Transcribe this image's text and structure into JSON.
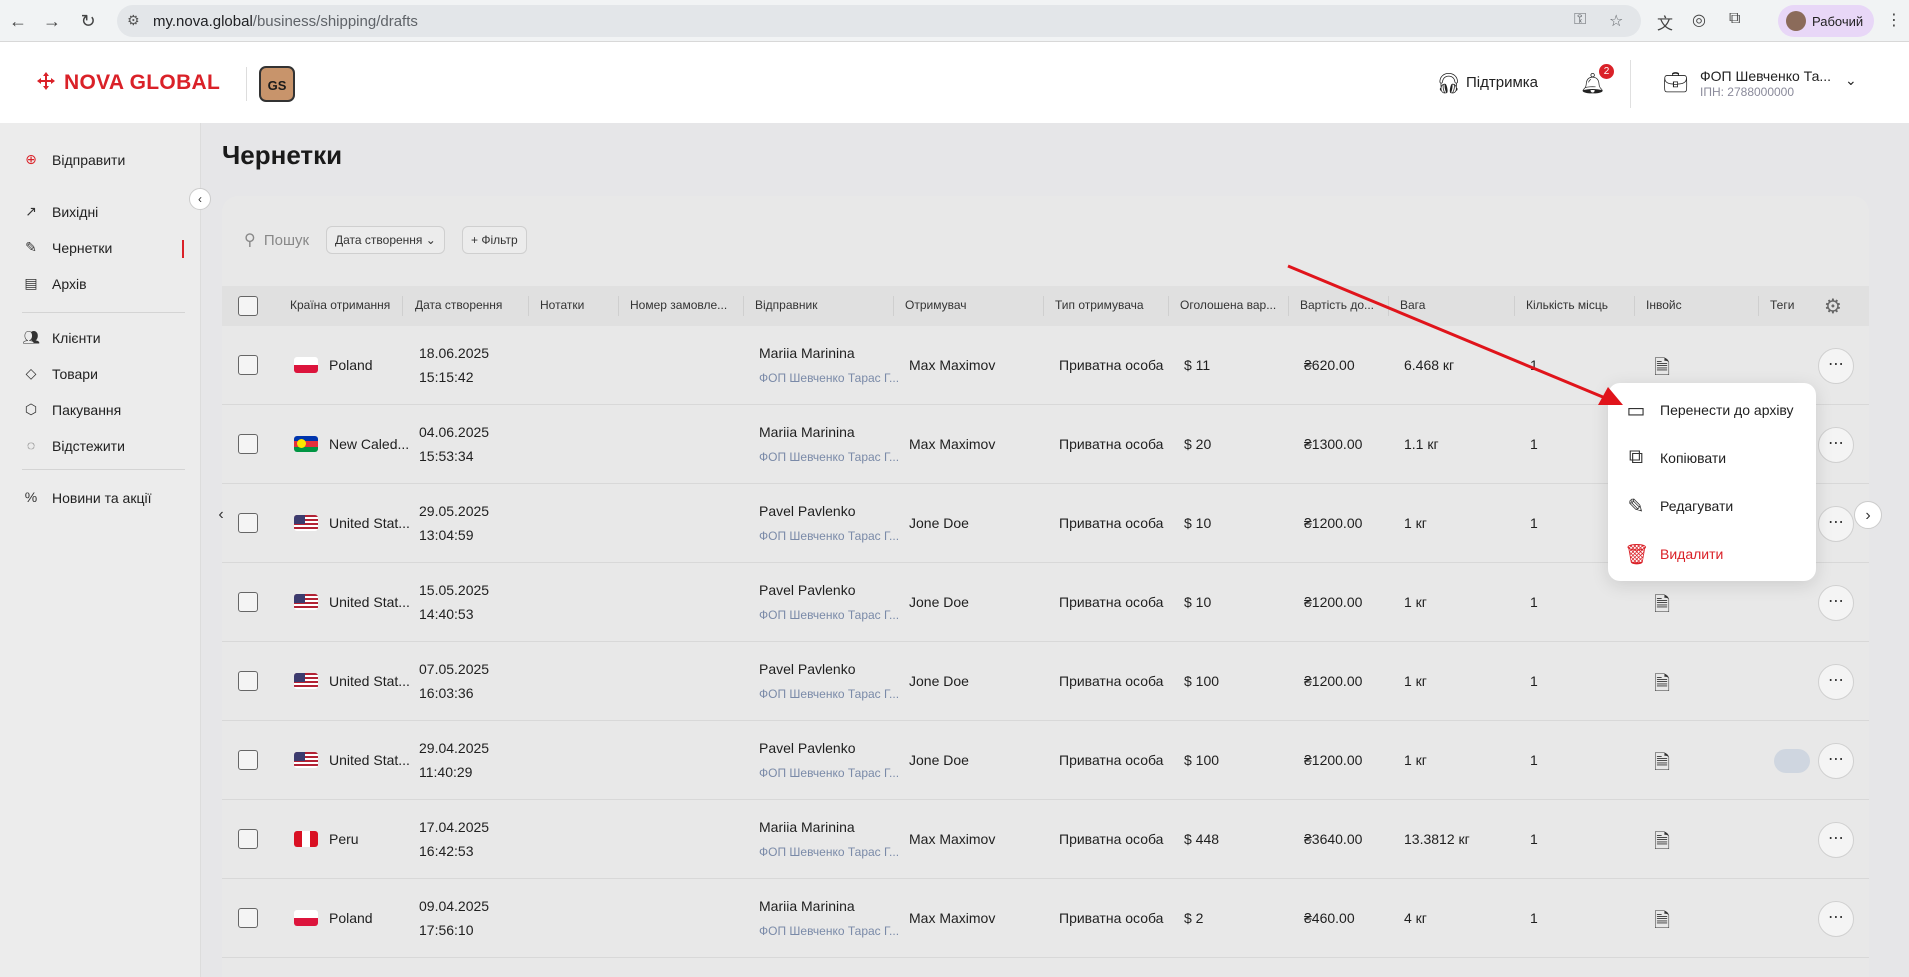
{
  "browser": {
    "url_host": "my.nova.global",
    "url_path": "/business/shipping/drafts",
    "profile_name": "Рабочий",
    "icons": [
      "back-icon",
      "forward-icon",
      "reload-icon",
      "tune-icon",
      "key-icon",
      "star-icon",
      "translate-icon",
      "camera-icon",
      "extensions-icon",
      "menu-icon"
    ]
  },
  "header": {
    "logo_text": "NOVA GLOBAL",
    "badge_text": "GS",
    "support_label": "Підтримка",
    "notification_count": "2",
    "business_name": "ФОП Шевченко Та...",
    "business_sub": "ІПН: 2788000000"
  },
  "sidebar": {
    "send_label": "Відправити",
    "items": [
      {
        "label": "Вихідні",
        "icon": "arrow-up-right-icon"
      },
      {
        "label": "Чернетки",
        "icon": "edit-icon"
      },
      {
        "label": "Архів",
        "icon": "archive-icon"
      },
      {
        "label": "Клієнти",
        "icon": "users-icon"
      },
      {
        "label": "Товари",
        "icon": "tag-icon"
      },
      {
        "label": "Пакування",
        "icon": "package-icon"
      },
      {
        "label": "Відстежити",
        "icon": "track-icon"
      },
      {
        "label": "Новини та акції",
        "icon": "percent-icon"
      }
    ]
  },
  "page": {
    "title": "Чернетки",
    "search_placeholder": "Пошук",
    "date_filter_label": "Дата створення",
    "add_filter_label": "+ Фільтр"
  },
  "table": {
    "columns": [
      "Країна отримання",
      "Дата створення",
      "Нотатки",
      "Номер замовле...",
      "Відправник",
      "Отримувач",
      "Тип отримувача",
      "Оголошена вар...",
      "Вартість до...",
      "Вага",
      "Кількість місць",
      "Інвойс",
      "Теги"
    ],
    "rows": [
      {
        "country": "Poland",
        "flag": "pl",
        "date": "18.06.2025",
        "time": "15:15:42",
        "sender": "Mariia Marinina",
        "sender_company": "ФОП Шевченко Тарас Г...",
        "recipient": "Max Maximov",
        "recipient_type": "Приватна особа",
        "declared": "$ 11",
        "cost": "₴620.00",
        "weight": "6.468 кг",
        "places": "1"
      },
      {
        "country": "New Caled...",
        "flag": "nc",
        "date": "04.06.2025",
        "time": "15:53:34",
        "sender": "Mariia Marinina",
        "sender_company": "ФОП Шевченко Тарас Г...",
        "recipient": "Max Maximov",
        "recipient_type": "Приватна особа",
        "declared": "$ 20",
        "cost": "₴1300.00",
        "weight": "1.1 кг",
        "places": "1"
      },
      {
        "country": "United Stat...",
        "flag": "us",
        "date": "29.05.2025",
        "time": "13:04:59",
        "sender": "Pavel Pavlenko",
        "sender_company": "ФОП Шевченко Тарас Г...",
        "recipient": "Jone Doe",
        "recipient_type": "Приватна особа",
        "declared": "$ 10",
        "cost": "₴1200.00",
        "weight": "1 кг",
        "places": "1"
      },
      {
        "country": "United Stat...",
        "flag": "us",
        "date": "15.05.2025",
        "time": "14:40:53",
        "sender": "Pavel Pavlenko",
        "sender_company": "ФОП Шевченко Тарас Г...",
        "recipient": "Jone Doe",
        "recipient_type": "Приватна особа",
        "declared": "$ 10",
        "cost": "₴1200.00",
        "weight": "1 кг",
        "places": "1"
      },
      {
        "country": "United Stat...",
        "flag": "us",
        "date": "07.05.2025",
        "time": "16:03:36",
        "sender": "Pavel Pavlenko",
        "sender_company": "ФОП Шевченко Тарас Г...",
        "recipient": "Jone Doe",
        "recipient_type": "Приватна особа",
        "declared": "$ 100",
        "cost": "₴1200.00",
        "weight": "1 кг",
        "places": "1"
      },
      {
        "country": "United Stat...",
        "flag": "us",
        "date": "29.04.2025",
        "time": "11:40:29",
        "sender": "Pavel Pavlenko",
        "sender_company": "ФОП Шевченко Тарас Г...",
        "recipient": "Jone Doe",
        "recipient_type": "Приватна особа",
        "declared": "$ 100",
        "cost": "₴1200.00",
        "weight": "1 кг",
        "places": "1"
      },
      {
        "country": "Peru",
        "flag": "pe",
        "date": "17.04.2025",
        "time": "16:42:53",
        "sender": "Mariia Marinina",
        "sender_company": "ФОП Шевченко Тарас Г...",
        "recipient": "Max Maximov",
        "recipient_type": "Приватна особа",
        "declared": "$ 448",
        "cost": "₴3640.00",
        "weight": "13.3812 кг",
        "places": "1"
      },
      {
        "country": "Poland",
        "flag": "pl",
        "date": "09.04.2025",
        "time": "17:56:10",
        "sender": "Mariia Marinina",
        "sender_company": "ФОП Шевченко Тарас Г...",
        "recipient": "Max Maximov",
        "recipient_type": "Приватна особа",
        "declared": "$ 2",
        "cost": "₴460.00",
        "weight": "4 кг",
        "places": "1"
      }
    ]
  },
  "context_menu": {
    "items": [
      {
        "label": "Перенести до архіву",
        "icon": "archive-icon"
      },
      {
        "label": "Копіювати",
        "icon": "copy-icon"
      },
      {
        "label": "Редагувати",
        "icon": "pencil-icon"
      },
      {
        "label": "Видалити",
        "icon": "trash-icon"
      }
    ]
  },
  "colors": {
    "brand_red": "#da2128",
    "secondary_text": "#7a8aa8"
  }
}
